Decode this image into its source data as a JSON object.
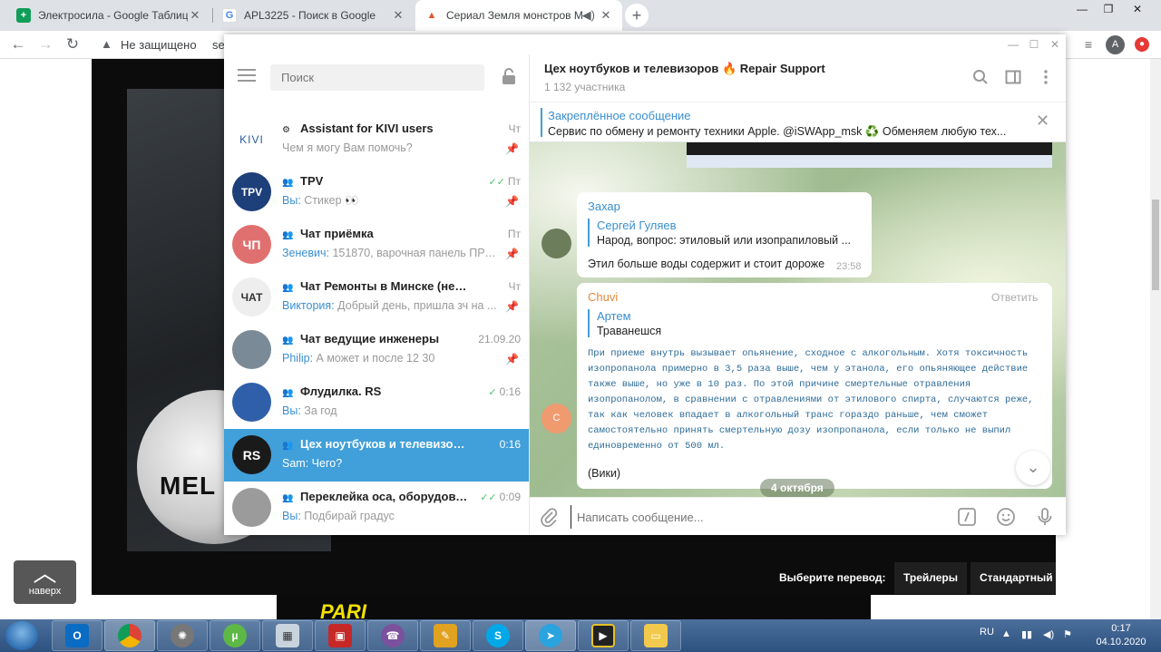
{
  "browser": {
    "tabs": [
      {
        "title": "Электросила - Google Таблицы",
        "icon": "sheets-icon",
        "color": "#0f9d58",
        "glyph": "+"
      },
      {
        "title": "APL3225 - Поиск в Google",
        "icon": "google-icon",
        "color": "#4285f4",
        "glyph": "G"
      },
      {
        "title": "Сериал Земля монстров М",
        "icon": "flame-icon",
        "color": "#e8552a",
        "glyph": "▲"
      }
    ],
    "address_warning": "Не защищено",
    "address_url": "se",
    "profile_initial": "A"
  },
  "page": {
    "scroll_top_label": "наверх",
    "translation_label": "Выберите перевод:",
    "translation_options": [
      "Трейлеры",
      "Стандартный"
    ],
    "poster_text": "MEL",
    "banner_text": "PARI"
  },
  "telegram": {
    "search_placeholder": "Поиск",
    "chats": [
      {
        "name": "Assistant for KIVI users",
        "time": "Чт",
        "who": "",
        "preview": "Чем я могу Вам помочь?",
        "avatar_text": "KIVI",
        "avatar_bg": "#ffffff",
        "avatar_fg": "#2a5c9a",
        "group": false,
        "bot": true,
        "ticks": "",
        "pinned": true
      },
      {
        "name": "TPV",
        "time": "Пт",
        "who": "Вы:",
        "preview": "Стикер 👀",
        "avatar_text": "TPV",
        "avatar_bg": "#1d3f7a",
        "avatar_fg": "#ffffff",
        "group": true,
        "ticks": "✓✓",
        "pinned": true
      },
      {
        "name": "Чат приёмка",
        "time": "Пт",
        "who": "Зеневич:",
        "preview": "151870, варочная панель ПРС...",
        "avatar_text": "ЧП",
        "avatar_bg": "#e0706f",
        "avatar_fg": "#ffffff",
        "group": true,
        "ticks": "",
        "pinned": true
      },
      {
        "name": "Чат Ремонты в Минске (не быт)",
        "time": "Чт",
        "who": "Виктория:",
        "preview": "Добрый день, пришла зч на ...",
        "avatar_text": "ЧАТ",
        "avatar_bg": "#eeeeee",
        "avatar_fg": "#333333",
        "group": true,
        "ticks": "",
        "pinned": true
      },
      {
        "name": "Чат ведущие инженеры",
        "time": "21.09.20",
        "who": "Philip:",
        "preview": "А может и после 12 30",
        "avatar_text": "",
        "avatar_bg": "#7a8a96",
        "avatar_fg": "#ffffff",
        "group": true,
        "ticks": "",
        "pinned": true
      },
      {
        "name": "Флудилка. RS",
        "time": "0:16",
        "who": "Вы:",
        "preview": "За год",
        "avatar_text": "",
        "avatar_bg": "#2f5fa8",
        "avatar_fg": "#ffffff",
        "group": true,
        "ticks": "✓",
        "pinned": false
      },
      {
        "name": "Цех ноутбуков и телевизоров ...",
        "time": "0:16",
        "who": "Sam:",
        "preview": "Чего?",
        "avatar_text": "RS",
        "avatar_bg": "#1a1a1a",
        "avatar_fg": "#ffffff",
        "group": true,
        "ticks": "",
        "pinned": false,
        "active": true
      },
      {
        "name": "Переклейка оса, оборудовани...",
        "time": "0:09",
        "who": "Вы:",
        "preview": "Подбирай градус",
        "avatar_text": "",
        "avatar_bg": "#9b9b9b",
        "avatar_fg": "#ffffff",
        "group": true,
        "ticks": "✓✓",
        "pinned": false
      }
    ],
    "chat": {
      "title": "Цех ноутбуков и телевизоров 🔥 Repair Support",
      "subtitle": "1 132 участника",
      "pinned_label": "Закреплённое сообщение",
      "pinned_text": "Сервис по обмену и ремонту техники Apple. @iSWApp_msk  ♻️ Обменяем любую тех...",
      "messages": [
        {
          "author": "Захар",
          "reply_name": "Сергей Гуляев",
          "reply_text": "Народ, вопрос:  этиловый или изопрапиловый ...",
          "text": "Этил больше воды содержит и стоит дороже",
          "time": "23:58"
        },
        {
          "author": "Chuvi",
          "reply_action": "Ответить",
          "reply_name": "Артем",
          "reply_text": "Траванешся",
          "body": "При приеме внутрь вызывает опьянение, сходное с алкогольным. Хотя токсичность изопропанола примерно в 3,5 раза выше, чем у этанола, его опьяняющее действие также выше, но уже в 10 раз. По этой причине смертельные отравления изопропанолом, в сравнении с отравлениями от этилового спирта, случаются реже, так как человек впадает в алкогольный транс гораздо раньше, чем сможет самостоятельно принять смертельную дозу изопропанола, если только не выпил единовременно от 500 мл.",
          "signature": "(Вики)",
          "avatar_text": "C"
        }
      ],
      "date_separator": "4 октября",
      "composer_placeholder": "Написать сообщение..."
    }
  },
  "taskbar": {
    "lang": "RU",
    "time": "0:17",
    "date": "04.10.2020"
  }
}
